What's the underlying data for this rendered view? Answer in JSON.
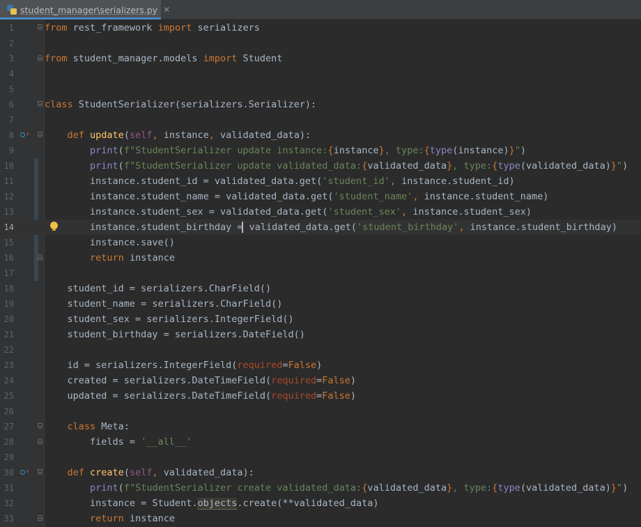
{
  "tab": {
    "title": "student_manager\\serializers.py",
    "close_glyph": "✕",
    "icon": "python-file-icon"
  },
  "gutter_icons": {
    "override": "override-method-icon",
    "bulb": "intention-bulb-icon"
  },
  "colors": {
    "background": "#2b2b2b",
    "keyword": "#cc7832",
    "string": "#6a8759",
    "self": "#94558d",
    "builtin": "#8888c6",
    "function_name": "#ffc66d",
    "kwarg": "#aa4926",
    "tab_accent": "#4a88c7"
  },
  "lines": [
    {
      "n": "1",
      "code": "from rest_framework import serializers"
    },
    {
      "n": "2",
      "code": ""
    },
    {
      "n": "3",
      "code": "from student_manager.models import Student"
    },
    {
      "n": "4",
      "code": ""
    },
    {
      "n": "5",
      "code": ""
    },
    {
      "n": "6",
      "code": "class StudentSerializer(serializers.Serializer):"
    },
    {
      "n": "7",
      "code": ""
    },
    {
      "n": "8",
      "code": "    def update(self, instance, validated_data):"
    },
    {
      "n": "9",
      "code": "        print(f\"StudentSerializer update instance:{instance}, type:{type(instance)}\")"
    },
    {
      "n": "10",
      "code": "        print(f\"StudentSerializer update validated_data:{validated_data}, type:{type(validated_data)}\")"
    },
    {
      "n": "11",
      "code": "        instance.student_id = validated_data.get('student_id', instance.student_id)"
    },
    {
      "n": "12",
      "code": "        instance.student_name = validated_data.get('student_name', instance.student_name)"
    },
    {
      "n": "13",
      "code": "        instance.student_sex = validated_data.get('student_sex', instance.student_sex)"
    },
    {
      "n": "14",
      "code": "        instance.student_birthday = validated_data.get('student_birthday', instance.student_birthday)"
    },
    {
      "n": "15",
      "code": "        instance.save()"
    },
    {
      "n": "16",
      "code": "        return instance"
    },
    {
      "n": "17",
      "code": ""
    },
    {
      "n": "18",
      "code": "    student_id = serializers.CharField()"
    },
    {
      "n": "19",
      "code": "    student_name = serializers.CharField()"
    },
    {
      "n": "20",
      "code": "    student_sex = serializers.IntegerField()"
    },
    {
      "n": "21",
      "code": "    student_birthday = serializers.DateField()"
    },
    {
      "n": "22",
      "code": ""
    },
    {
      "n": "23",
      "code": "    id = serializers.IntegerField(required=False)"
    },
    {
      "n": "24",
      "code": "    created = serializers.DateTimeField(required=False)"
    },
    {
      "n": "25",
      "code": "    updated = serializers.DateTimeField(required=False)"
    },
    {
      "n": "26",
      "code": ""
    },
    {
      "n": "27",
      "code": "    class Meta:"
    },
    {
      "n": "28",
      "code": "        fields = '__all__'"
    },
    {
      "n": "29",
      "code": ""
    },
    {
      "n": "30",
      "code": "    def create(self, validated_data):"
    },
    {
      "n": "31",
      "code": "        print(f\"StudentSerializer create validated_data:{validated_data}, type:{type(validated_data)}\")"
    },
    {
      "n": "32",
      "code": "        instance = Student.objects.create(**validated_data)"
    },
    {
      "n": "33",
      "code": "        return instance"
    }
  ]
}
